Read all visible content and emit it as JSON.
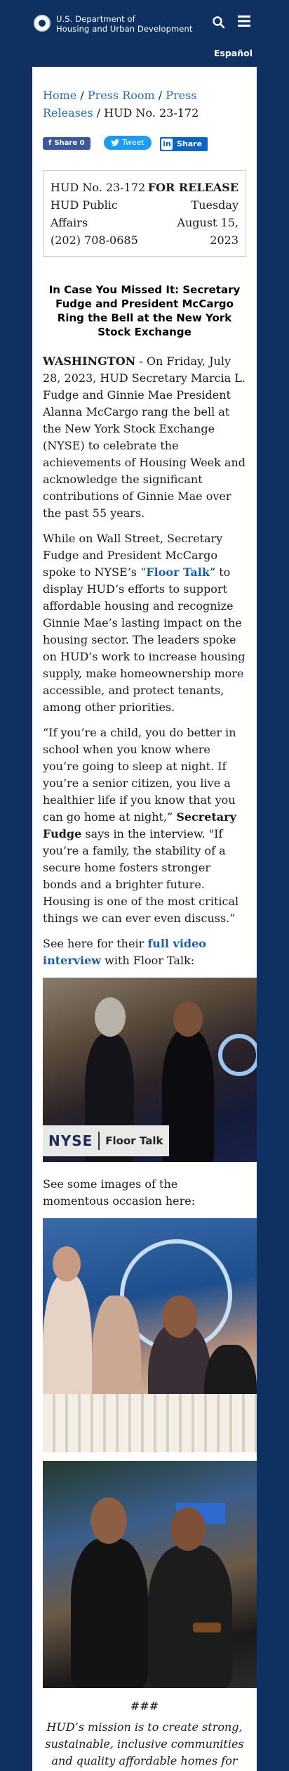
{
  "header": {
    "agency_line1": "U.S. Department of",
    "agency_line2": "Housing and Urban Development",
    "language_link": "Español"
  },
  "breadcrumb": {
    "home": "Home",
    "press_room": "Press Room",
    "press_releases": "Press Releases",
    "separator": "/",
    "current": "HUD No. 23-172"
  },
  "share": {
    "facebook_label": "Share 0",
    "twitter_label": "Tweet",
    "linkedin_label": "Share"
  },
  "release_info": {
    "number": "HUD No. 23-172",
    "office_line1": "HUD Public",
    "office_line2": "Affairs",
    "phone": "(202) 708-0685",
    "release_label": "FOR RELEASE",
    "day": "Tuesday",
    "date": "August 15,",
    "year": "2023"
  },
  "article": {
    "headline": "In Case You Missed It: Secretary Fudge and President McCargo Ring the Bell at the New York Stock Exchange",
    "p1_dateline": "WASHINGTON",
    "p1_body": " - On Friday, July 28, 2023, HUD Secretary Marcia L. Fudge and Ginnie Mae President Alanna McCargo rang the bell at the New York Stock Exchange (NYSE) to celebrate the achievements of Housing Week and acknowledge the significant contributions of Ginnie Mae over the past 55 years.",
    "p2_before": "While on Wall Street, Secretary Fudge and President McCargo spoke to NYSE’s “",
    "p2_link": "Floor Talk",
    "p2_after": "” to display HUD’s efforts to support affordable housing and recognize Ginnie Mae’s lasting impact on the housing sector. The leaders spoke on HUD’s work to increase housing supply, make homeownership more accessible, and protect tenants, among other priorities.",
    "p3_before": "“If you’re a child, you do better in school when you know where you’re going to sleep at night. If you’re a senior citizen, you live a healthier life if you know that you can go home at night,” ",
    "p3_bold": "Secretary Fudge",
    "p3_after": " says in the interview. \"If you’re a family, the stability of a secure home fosters stronger bonds and a brighter future. Housing is one of the most critical things we can ever even discuss.”",
    "p4_before": "See here for their ",
    "p4_link": "full video interview",
    "p4_after": " with Floor Talk:",
    "video_overlay_left": "NYSE",
    "video_overlay_right": "Floor Talk",
    "p5": "See some images of the momentous occasion here:",
    "separator": "###",
    "mission": "HUD’s mission is to create strong, sustainable, inclusive communities and quality affordable homes for all. More information about HUD and its programs is available at"
  },
  "colors": {
    "navy": "#0f3162",
    "link_blue": "#2b6cb0",
    "facebook": "#3b5998",
    "twitter": "#1d9bf0",
    "linkedin": "#0a66c2"
  }
}
